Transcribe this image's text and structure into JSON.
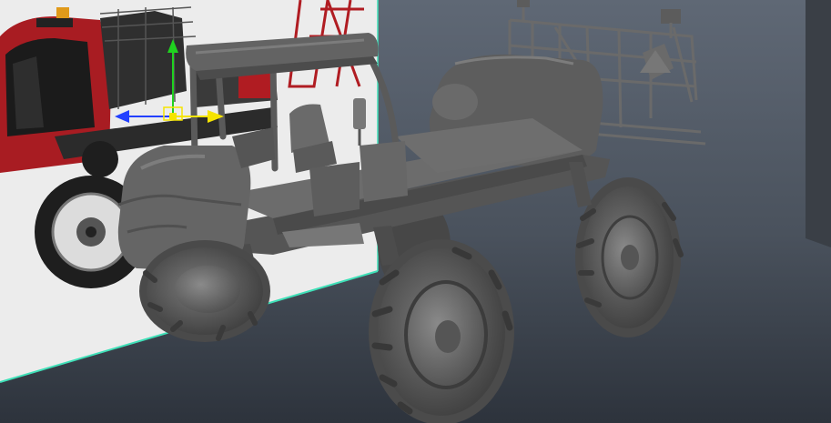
{
  "viewport": {
    "background_top": "#5f6875",
    "background_bottom": "#2d333c",
    "model_color": "#5d5d5d",
    "model_dark": "#3c3c3c",
    "model_light": "#7a7a7a",
    "reference_bg": "#eeeeee",
    "reference_red": "#b01c22",
    "selection_outline": "#3fe0b8"
  },
  "manipulator": {
    "x_axis_color": "#f5e400",
    "y_axis_color": "#1fd21f",
    "z_axis_color": "#2340ff",
    "pivot_color": "#f5e400",
    "icon": "move-tool-icon"
  }
}
